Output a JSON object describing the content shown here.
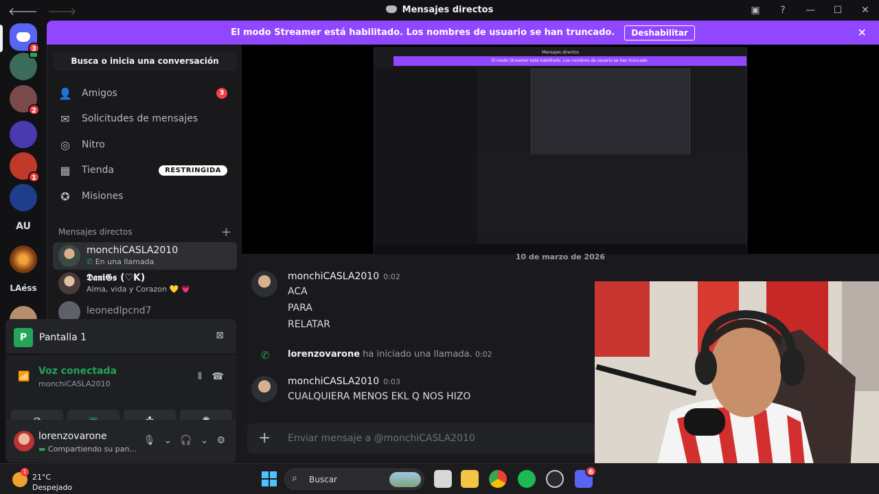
{
  "titlebar": {
    "title": "Mensajes directos",
    "back_icon": "arrow-left-icon",
    "forward_icon": "arrow-right-icon"
  },
  "guilds": {
    "home_badge": "3",
    "items": [
      {
        "badge": "",
        "color": "#3b6b5a"
      },
      {
        "badge": "2",
        "color": "#7a4a4a"
      },
      {
        "badge": "",
        "color": "#4a3ab0"
      },
      {
        "badge": "1",
        "color": "#c0392b"
      },
      {
        "badge": "",
        "color": "#1f3d8a"
      }
    ],
    "text_au": "AU",
    "text_laess": "LAéss"
  },
  "banner": {
    "message": "El modo Streamer está habilitado. Los nombres de usuario se han truncado.",
    "button": "Deshabilitar"
  },
  "sidebar": {
    "search": "Busca o inicia una conversación",
    "nav": [
      {
        "label": "Amigos",
        "badge": "3",
        "tag": ""
      },
      {
        "label": "Solicitudes de mensajes",
        "badge": "",
        "tag": ""
      },
      {
        "label": "Nitro",
        "badge": "",
        "tag": ""
      },
      {
        "label": "Tienda",
        "badge": "",
        "tag": "RESTRINGIDA"
      },
      {
        "label": "Misiones",
        "badge": "",
        "tag": ""
      }
    ],
    "dm_header": "Mensajes directos",
    "dms": [
      {
        "name": "monchiCASLA2010",
        "status": "En una llamada"
      },
      {
        "name": "𝕯𝖆𝖓𝖎𝕲𝖘 (♡K)",
        "status": "Alma, vida y Corazon 💛 💗"
      },
      {
        "name": "leonedlpcnd7",
        "status": ""
      }
    ]
  },
  "voice": {
    "screen_title": "Pantalla 1",
    "connected": "Voz conectada",
    "channel": "monchiCASLA2010"
  },
  "user": {
    "name": "lorenzovarone",
    "status": "Compartiendo su pan..."
  },
  "chat": {
    "date": "10 de marzo de 2026",
    "messages": [
      {
        "author": "monchiCASLA2010",
        "time": "0:02",
        "lines": [
          "ACA",
          "PARA",
          "RELATAR"
        ]
      },
      {
        "author": "monchiCASLA2010",
        "time": "0:03",
        "lines": [
          "CUALQUIERA MENOS EKL Q NOS HIZO"
        ]
      }
    ],
    "system": {
      "user": "lorenzovarone",
      "text": "ha iniciado una llamada.",
      "time": "0:02"
    },
    "composer_placeholder": "Enviar mensaje a @monchiCASLA2010"
  },
  "taskbar": {
    "temp": "21°C",
    "condition": "Despejado",
    "weather_badge": "1",
    "search": "Buscar",
    "discord_badge": "6"
  },
  "colors": {
    "streamer_banner": "#9147ff",
    "online_green": "#23a55a",
    "badge_red": "#f23f43"
  }
}
